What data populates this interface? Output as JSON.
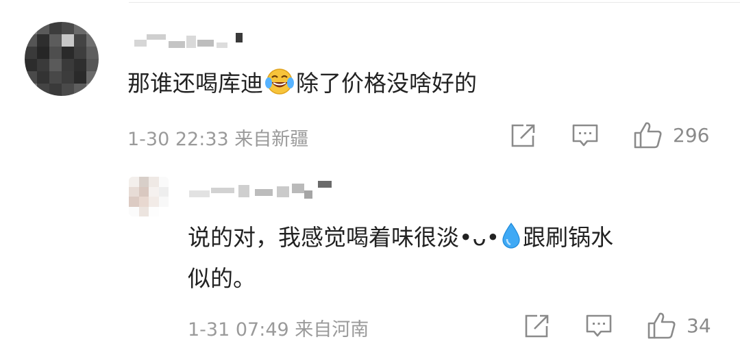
{
  "comment": {
    "text_before_emoji": "那谁还喝库迪",
    "emoji": "laughing-tears-emoji",
    "text_after_emoji": "除了价格没啥好的",
    "time": "1-30 22:33 来自新疆",
    "like_count": "296"
  },
  "reply": {
    "text_part1": "说的对，我感觉喝着味很淡•ᴗ•",
    "emoji": "droplet-emoji",
    "text_part2": "跟刷锅水",
    "text_line2": "似的。",
    "time": "1-31 07:49 来自河南",
    "like_count": "34"
  },
  "icons": {
    "share": "share-icon",
    "comment": "comment-icon",
    "like": "thumbs-up-icon"
  },
  "colors": {
    "text": "#222222",
    "meta": "#9a9a9a",
    "icon": "#8a8a8a"
  }
}
